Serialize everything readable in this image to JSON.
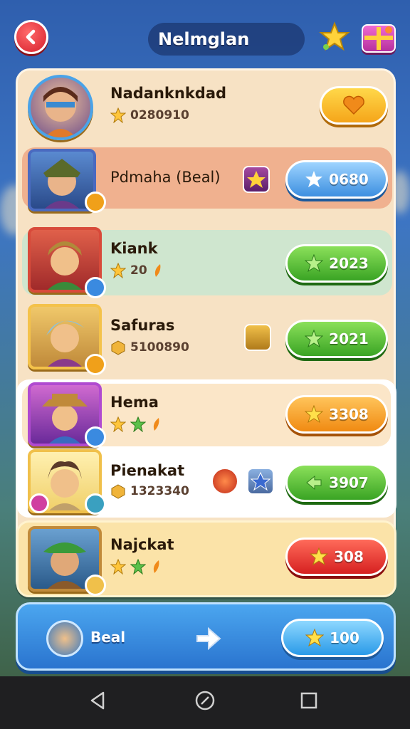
{
  "header": {
    "title": "Nelmglan",
    "back_icon": "back-arrow-icon",
    "star_icon": "star-icon",
    "gift_icon": "gift-box-icon"
  },
  "players": [
    {
      "name": "Nadanknkdad",
      "sub_text": "0280910",
      "button_text": "",
      "button_icon": "heart-icon",
      "button_color": "yellow"
    },
    {
      "name": "Pdmaha (Beal)",
      "sub_text": "",
      "button_text": "0680",
      "button_icon": "star-icon",
      "button_color": "blue"
    },
    {
      "name": "Kiank",
      "sub_text": "20",
      "button_text": "2023",
      "button_icon": "star-icon",
      "button_color": "green"
    },
    {
      "name": "Safuras",
      "sub_text": "5100890",
      "button_text": "2021",
      "button_icon": "star-icon",
      "button_color": "green"
    },
    {
      "name": "Hema",
      "sub_text": "",
      "button_text": "3308",
      "button_icon": "star-icon",
      "button_color": "orange"
    },
    {
      "name": "Pienakat",
      "sub_text": "1323340",
      "button_text": "3907",
      "button_icon": "arrow-icon",
      "button_color": "green"
    },
    {
      "name": "Najckat",
      "sub_text": "",
      "button_text": "308",
      "button_icon": "star-icon",
      "button_color": "red"
    }
  ],
  "footer": {
    "label": "Beal",
    "button_text": "100",
    "share_icon": "share-arrow-icon"
  },
  "nav": {
    "back": "nav-back-icon",
    "home": "nav-home-icon",
    "recents": "nav-recents-icon"
  }
}
